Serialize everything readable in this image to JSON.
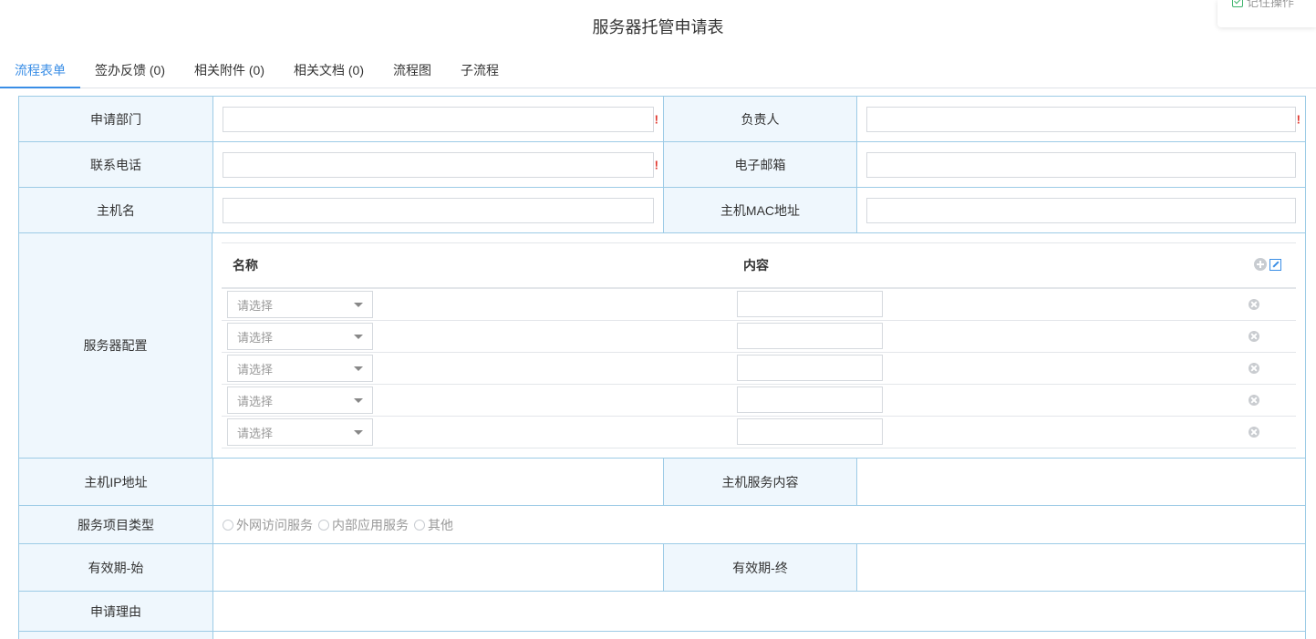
{
  "float_panel": {
    "label": "记住操作"
  },
  "page_title": "服务器托管申请表",
  "tabs": [
    {
      "label": "流程表单",
      "active": true
    },
    {
      "label": "签办反馈 (0)"
    },
    {
      "label": "相关附件 (0)"
    },
    {
      "label": "相关文档 (0)"
    },
    {
      "label": "流程图"
    },
    {
      "label": "子流程"
    }
  ],
  "form": {
    "row1": {
      "label_left": "申请部门",
      "label_right": "负责人",
      "value_left": "",
      "value_right": "",
      "required_mark": "!"
    },
    "row2": {
      "label_left": "联系电话",
      "label_right": "电子邮箱",
      "value_left": "",
      "value_right": "",
      "required_mark": "!"
    },
    "row3": {
      "label_left": "主机名",
      "label_right": "主机MAC地址",
      "value_left": "",
      "value_right": ""
    },
    "server_config": {
      "label": "服务器配置",
      "col_name": "名称",
      "col_content": "内容",
      "rows": [
        {
          "select_placeholder": "请选择",
          "content": ""
        },
        {
          "select_placeholder": "请选择",
          "content": ""
        },
        {
          "select_placeholder": "请选择",
          "content": ""
        },
        {
          "select_placeholder": "请选择",
          "content": ""
        },
        {
          "select_placeholder": "请选择",
          "content": ""
        }
      ]
    },
    "row_ip": {
      "label_left": "主机IP地址",
      "label_right": "主机服务内容",
      "value_left": "",
      "value_right": ""
    },
    "service_type": {
      "label": "服务项目类型",
      "options": [
        "外网访问服务",
        "内部应用服务",
        "其他"
      ]
    },
    "row_validity": {
      "label_left": "有效期-始",
      "label_right": "有效期-终",
      "value_left": "",
      "value_right": ""
    },
    "reason": {
      "label": "申请理由",
      "value": ""
    }
  },
  "colors": {
    "accent": "#3a8ee6",
    "label_bg": "#eff7fd",
    "border": "#9ccbe6",
    "required": "#e0352b"
  }
}
